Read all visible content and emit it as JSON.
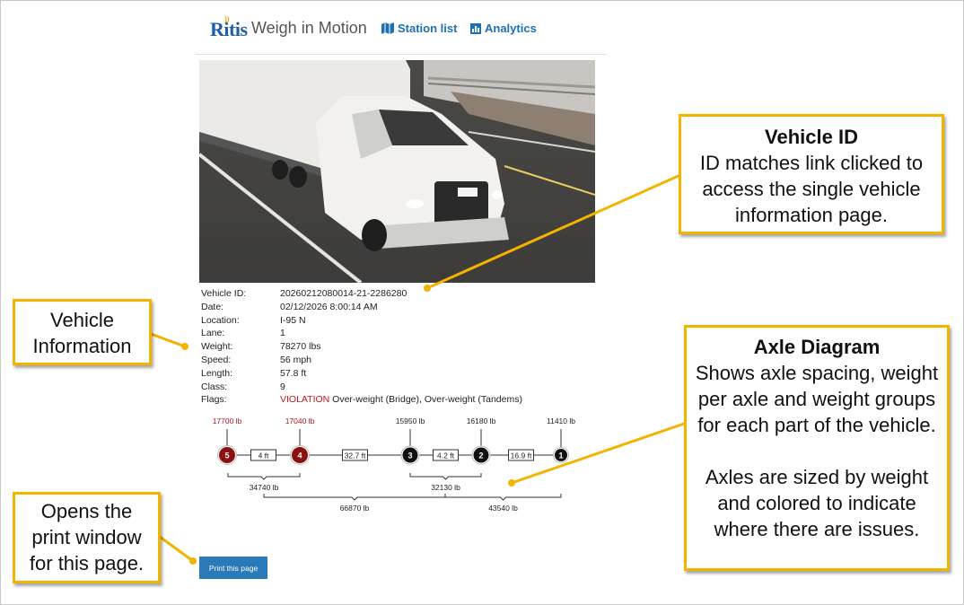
{
  "header": {
    "logo_text": "Ritis",
    "app_title": "Weigh in Motion",
    "nav": [
      {
        "label": "Station list",
        "icon": "map-icon"
      },
      {
        "label": "Analytics",
        "icon": "bar-chart-icon"
      }
    ]
  },
  "photo": {
    "alt": "Truck camera image"
  },
  "vehicle": {
    "fields": [
      {
        "label": "Vehicle ID:",
        "value": "20260212080014-21-2286280"
      },
      {
        "label": "Date:",
        "value": "02/12/2026 8:00:14 AM"
      },
      {
        "label": "Location:",
        "value": "I-95 N"
      },
      {
        "label": "Lane:",
        "value": "1"
      },
      {
        "label": "Weight:",
        "value": "78270 lbs"
      },
      {
        "label": "Speed:",
        "value": "56 mph"
      },
      {
        "label": "Length:",
        "value": "57.8 ft"
      },
      {
        "label": "Class:",
        "value": "9"
      }
    ],
    "flags_label": "Flags:",
    "flags_violation": "VIOLATION",
    "flags_text": "Over-weight (Bridge), Over-weight (Tandems)"
  },
  "axles": {
    "items": [
      {
        "number": "5",
        "weight": "17700 lb",
        "status": "violation"
      },
      {
        "number": "4",
        "weight": "17040 lb",
        "status": "violation"
      },
      {
        "number": "3",
        "weight": "15950 lb",
        "status": "ok"
      },
      {
        "number": "2",
        "weight": "16180 lb",
        "status": "ok"
      },
      {
        "number": "1",
        "weight": "11410 lb",
        "status": "ok"
      }
    ],
    "spacings": [
      "4 ft",
      "32.7 ft",
      "4.2 ft",
      "16.9 ft"
    ],
    "groups": [
      {
        "label": "34740 lb"
      },
      {
        "label": "32130 lb"
      },
      {
        "label": "66870 lb"
      },
      {
        "label": "43540 lb"
      }
    ],
    "colors": {
      "violation": "#8b1010",
      "ok": "#111111",
      "violation_text": "#b01818"
    }
  },
  "print_button": {
    "label": "Print this page"
  },
  "callouts": {
    "vehicle_id": {
      "title": "Vehicle ID",
      "body": "ID matches link clicked to access the single vehicle information page."
    },
    "vehicle_info": {
      "body": "Vehicle Information"
    },
    "axle_diagram": {
      "title": "Axle Diagram",
      "body1": "Shows axle spacing, weight per axle and weight groups for each part of the vehicle.",
      "body2": "Axles are sized by weight and colored to indicate where there are issues."
    },
    "print": {
      "body": "Opens the print window for this page."
    }
  },
  "accent_color": "#f2b400"
}
